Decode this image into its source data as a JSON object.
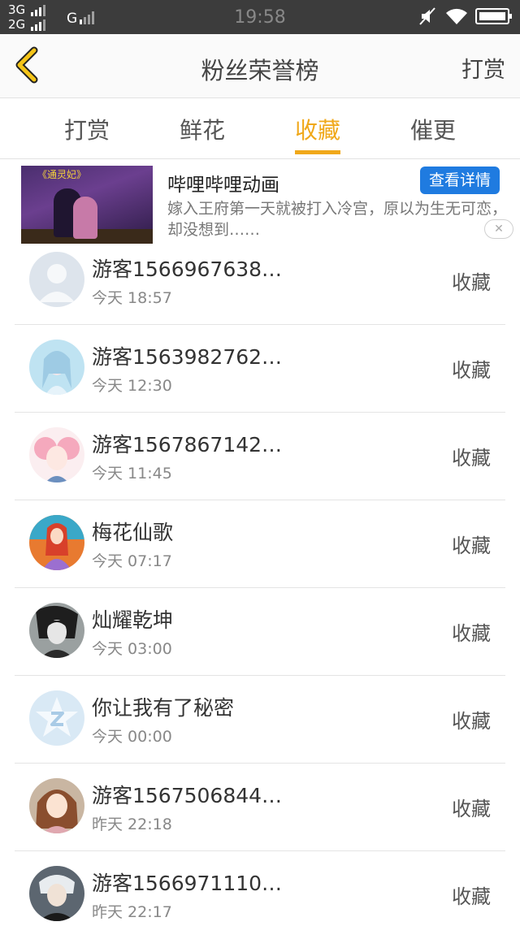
{
  "status_bar": {
    "network1": "3G",
    "network2": "2G",
    "carrier": "G",
    "time": "19:58"
  },
  "header": {
    "title": "粉丝荣誉榜",
    "right_button": "打赏"
  },
  "tabs": [
    {
      "label": "打赏"
    },
    {
      "label": "鲜花"
    },
    {
      "label": "收藏"
    },
    {
      "label": "催更"
    }
  ],
  "active_tab": "收藏",
  "ad": {
    "thumb_caption": "《通灵妃》",
    "title": "哔哩哔哩动画",
    "button": "查看详情",
    "description": "嫁入王府第一天就被打入冷宫，原以为生无可恋，却没想到……",
    "close": "✕"
  },
  "users": [
    {
      "name": "游客1566967638…",
      "time": "今天 18:57",
      "action": "收藏"
    },
    {
      "name": "游客1563982762…",
      "time": "今天 12:30",
      "action": "收藏"
    },
    {
      "name": "游客1567867142…",
      "time": "今天 11:45",
      "action": "收藏"
    },
    {
      "name": "梅花仙歌",
      "time": "今天 07:17",
      "action": "收藏"
    },
    {
      "name": "灿耀乾坤",
      "time": "今天 03:00",
      "action": "收藏"
    },
    {
      "name": "你让我有了秘密",
      "time": "今天 00:00",
      "action": "收藏"
    },
    {
      "name": "游客1567506844…",
      "time": "昨天 22:18",
      "action": "收藏"
    },
    {
      "name": "游客1566971110…",
      "time": "昨天 22:17",
      "action": "收藏"
    }
  ],
  "colors": {
    "accent": "#f0a81a",
    "ad_button": "#1f7be0",
    "status_bar": "#3c3c3c"
  }
}
